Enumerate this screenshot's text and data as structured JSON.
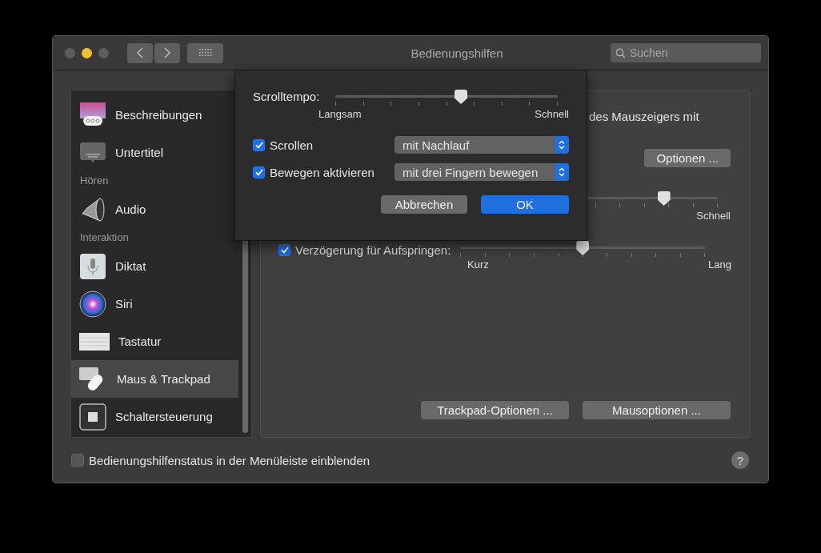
{
  "window": {
    "title": "Bedienungshilfen",
    "search": {
      "placeholder": "Suchen"
    }
  },
  "sidebar": {
    "items": [
      {
        "kind": "item",
        "label": "Beschreibungen",
        "selected": false
      },
      {
        "kind": "item",
        "label": "Untertitel",
        "selected": false
      },
      {
        "kind": "header",
        "label": "Hören"
      },
      {
        "kind": "item",
        "label": "Audio",
        "selected": false
      },
      {
        "kind": "header",
        "label": "Interaktion"
      },
      {
        "kind": "item",
        "label": "Diktat",
        "selected": false
      },
      {
        "kind": "item",
        "label": "Siri",
        "selected": false
      },
      {
        "kind": "item",
        "label": "Tastatur",
        "selected": false
      },
      {
        "kind": "item",
        "label": "Maus & Trackpad",
        "selected": true
      },
      {
        "kind": "item",
        "label": "Schaltersteuerung",
        "selected": false
      }
    ]
  },
  "panel": {
    "partial_text": "des Mauszeigers mit",
    "options_button": "Optionen ...",
    "speed_slider": {
      "level": 0.78,
      "max_label": "Schnell"
    },
    "spring_delay": {
      "label": "Verzögerung für Aufspringen:",
      "checked": true,
      "level": 0.5,
      "min_label": "Kurz",
      "max_label": "Lang"
    },
    "buttons": [
      "Trackpad-Optionen ...",
      "Mausoptionen ..."
    ]
  },
  "footer": {
    "checkbox": {
      "label": "Bedienungshilfenstatus in der Menüleiste einblenden",
      "checked": false
    },
    "help": "?"
  },
  "sheet": {
    "slider": {
      "label": "Scrolltempo:",
      "level": 0.565,
      "min_label": "Langsam",
      "max_label": "Schnell"
    },
    "options": [
      {
        "label": "Scrollen",
        "checked": true,
        "value": "mit Nachlauf"
      },
      {
        "label": "Bewegen aktivieren",
        "checked": true,
        "value": "mit drei Fingern bewegen"
      }
    ],
    "buttons": [
      {
        "label": "Abbrechen",
        "kind": "cancel"
      },
      {
        "label": "OK",
        "kind": "default"
      }
    ]
  }
}
